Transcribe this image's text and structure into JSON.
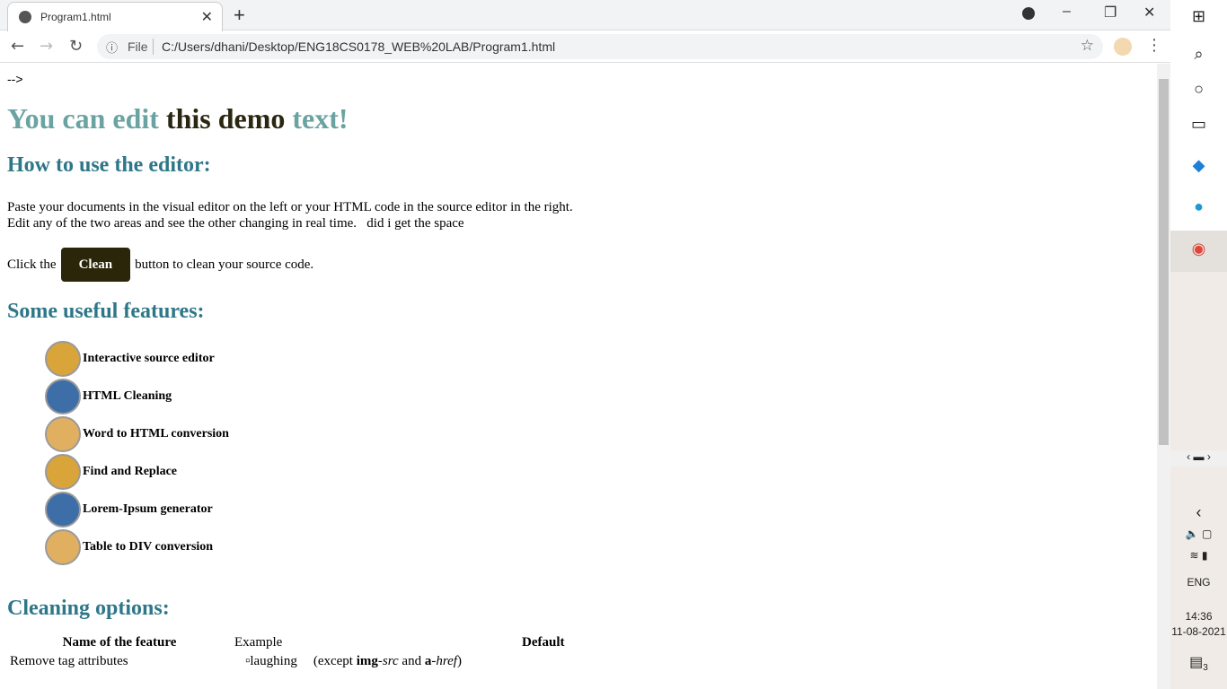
{
  "browser": {
    "tab_title": "Program1.html",
    "file_label": "File",
    "url": "C:/Users/dhani/Desktop/ENG18CS0178_WEB%20LAB/Program1.html"
  },
  "page": {
    "comment_residue": "-->",
    "h1": {
      "part1": "You can edit",
      "part2": "this demo",
      "part3": "text!"
    },
    "h2_howto": "How to use the editor:",
    "para1_line1": "Paste your documents in the visual editor on the left or your HTML code in the source editor in the right.",
    "para1_line2": "Edit any of the two areas and see the other changing in real time.   did i get the space",
    "click_pre": "Click the",
    "clean_label": "Clean",
    "click_post": "button to clean your source code.",
    "h2_features": "Some useful features:",
    "features": [
      {
        "label": "Interactive source editor",
        "color": "#d9a43a"
      },
      {
        "label": "HTML Cleaning",
        "color": "#3e6ea8"
      },
      {
        "label": "Word to HTML conversion",
        "color": "#e0b060"
      },
      {
        "label": "Find and Replace",
        "color": "#d9a43a"
      },
      {
        "label": "Lorem-Ipsum generator",
        "color": "#3e6ea8"
      },
      {
        "label": "Table to DIV conversion",
        "color": "#e0b060"
      }
    ],
    "h2_cleaning": "Cleaning options:",
    "table": {
      "headers": [
        "Name of the feature",
        "Example",
        "Default"
      ],
      "row1": {
        "name": "Remove tag attributes",
        "img_alt": "laughing",
        "except": "(except ",
        "img": "img",
        "dash": "-",
        "src": "src",
        "and": " and ",
        "a": "a",
        "href": "href",
        "close": ")"
      }
    }
  },
  "taskbar": {
    "lang": "ENG",
    "time": "14:36",
    "date": "11-08-2021",
    "notif_count": "3"
  }
}
